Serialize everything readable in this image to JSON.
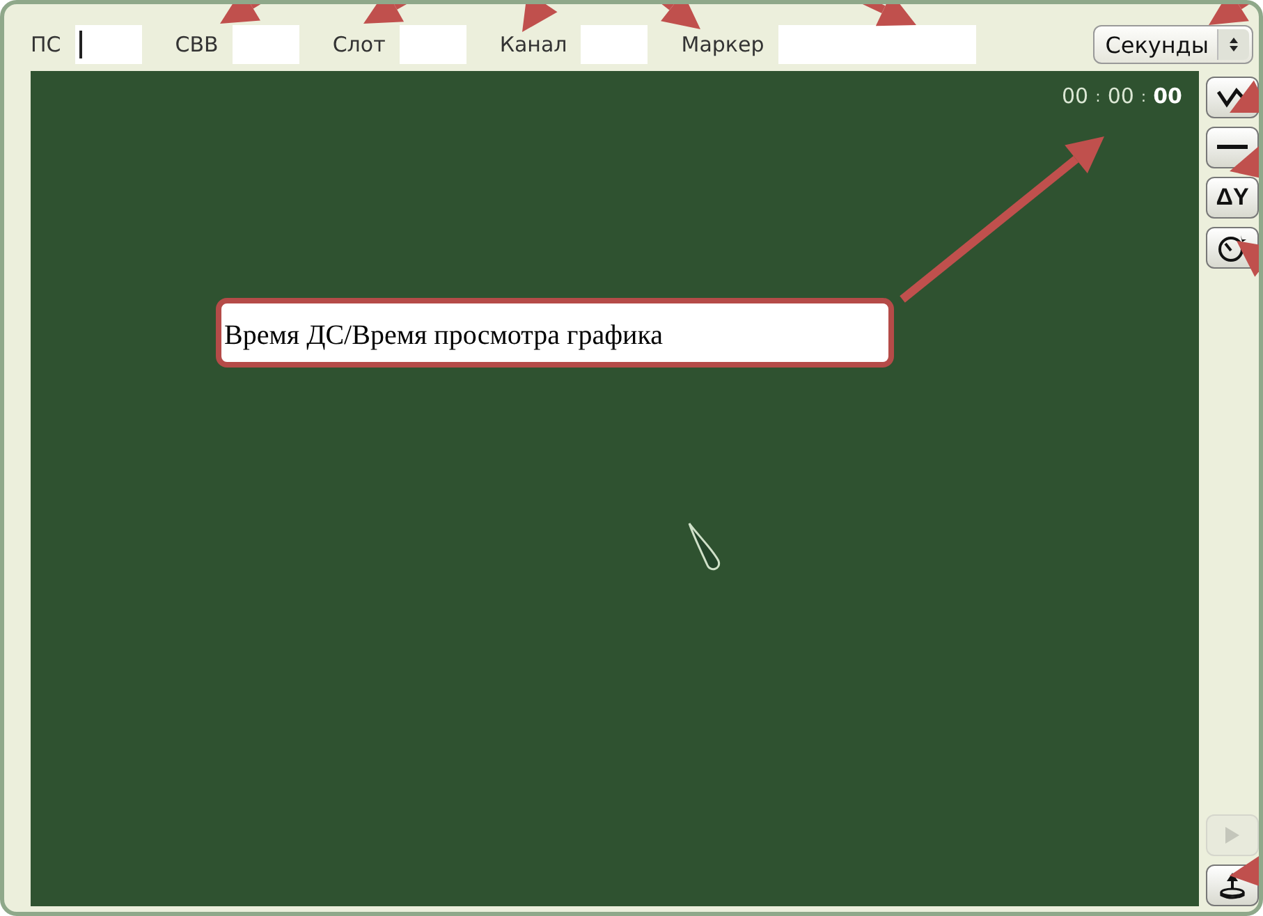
{
  "toolbar": {
    "fields": [
      {
        "label": "ПС",
        "focused": true,
        "wide": false
      },
      {
        "label": "СВВ",
        "focused": false,
        "wide": false
      },
      {
        "label": "Слот",
        "focused": false,
        "wide": false
      },
      {
        "label": "Канал",
        "focused": false,
        "wide": false
      },
      {
        "label": "Маркер",
        "focused": false,
        "wide": true
      }
    ],
    "unit_select": {
      "value": "Секунды"
    }
  },
  "timer": [
    {
      "kind": "digits",
      "text": "00",
      "bold": false
    },
    {
      "kind": "sep",
      "text": ":",
      "bold": false
    },
    {
      "kind": "digits",
      "text": "00",
      "bold": false
    },
    {
      "kind": "sep",
      "text": ":",
      "bold": false
    },
    {
      "kind": "digits",
      "text": "00",
      "bold": true
    }
  ],
  "side_tools": [
    {
      "kind": "wave",
      "disabled": false
    },
    {
      "kind": "line",
      "disabled": false
    },
    {
      "kind": "text",
      "text": "ΔY",
      "disabled": false
    },
    {
      "kind": "gauge",
      "disabled": false
    }
  ],
  "bottom_tools": [
    {
      "kind": "play",
      "disabled": true
    },
    {
      "kind": "eject",
      "disabled": false
    }
  ],
  "callout": {
    "text": "Время ДС/Время просмотра графика"
  }
}
